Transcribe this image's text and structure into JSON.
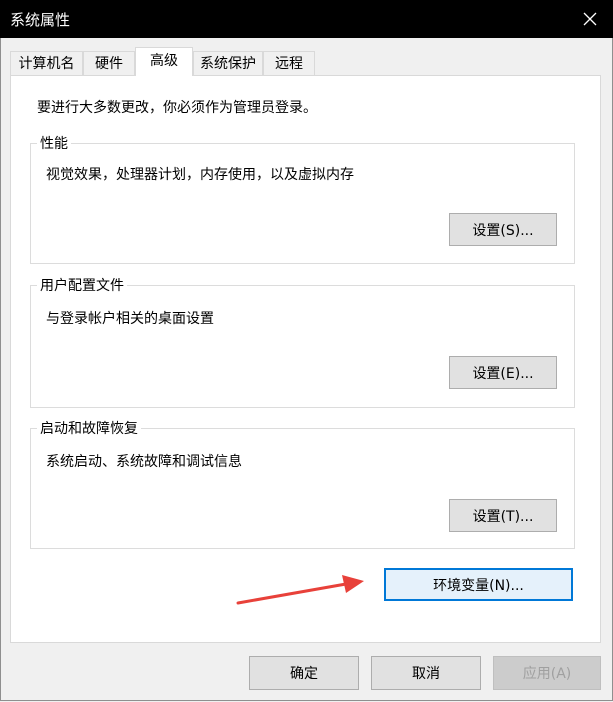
{
  "window": {
    "title": "系统属性",
    "close_icon": "close-icon"
  },
  "tabs": [
    {
      "label": "计算机名",
      "active": false
    },
    {
      "label": "硬件",
      "active": false
    },
    {
      "label": "高级",
      "active": true
    },
    {
      "label": "系统保护",
      "active": false
    },
    {
      "label": "远程",
      "active": false
    }
  ],
  "advanced": {
    "intro": "要进行大多数更改，你必须作为管理员登录。",
    "performance": {
      "legend": "性能",
      "description": "视觉效果，处理器计划，内存使用，以及虚拟内存",
      "button": "设置(S)..."
    },
    "user_profiles": {
      "legend": "用户配置文件",
      "description": "与登录帐户相关的桌面设置",
      "button": "设置(E)..."
    },
    "startup_recovery": {
      "legend": "启动和故障恢复",
      "description": "系统启动、系统故障和调试信息",
      "button": "设置(T)..."
    },
    "env_button": "环境变量(N)..."
  },
  "footer": {
    "ok": "确定",
    "cancel": "取消",
    "apply": "应用(A)"
  },
  "colors": {
    "annotation_arrow": "#e8413a",
    "focus_border": "#0078d7"
  }
}
